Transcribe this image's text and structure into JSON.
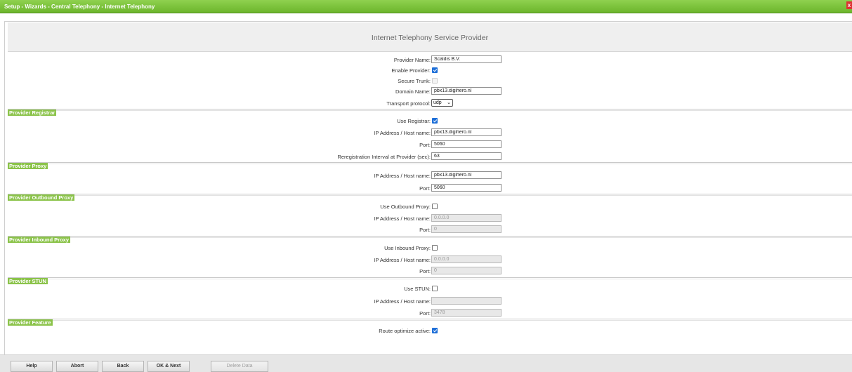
{
  "window": {
    "breadcrumb": "Setup - Wizards - Central Telephony - Internet Telephony",
    "close_glyph": "x"
  },
  "page": {
    "title": "Internet Telephony Service Provider"
  },
  "general": {
    "provider_name_label": "Provider Name:",
    "provider_name_value": "Scaldis B.V.",
    "enable_provider_label": "Enable Provider:",
    "enable_provider_checked": true,
    "secure_trunk_label": "Secure Trunk:",
    "secure_trunk_checked": false,
    "domain_name_label": "Domain Name:",
    "domain_name_value": "pbx13.digihero.nl",
    "transport_label": "Transport protocol:",
    "transport_value": "udp"
  },
  "registrar": {
    "section_label": "Provider Registrar",
    "use_label": "Use Registrar:",
    "use_checked": true,
    "host_label": "IP Address / Host name:",
    "host_value": "pbx13.digihero.nl",
    "port_label": "Port:",
    "port_value": "5060",
    "interval_label": "Reregistration Interval at Provider (sec):",
    "interval_value": "63"
  },
  "proxy": {
    "section_label": "Provider Proxy",
    "host_label": "IP Address / Host name:",
    "host_value": "pbx13.digihero.nl",
    "port_label": "Port:",
    "port_value": "5060"
  },
  "outbound_proxy": {
    "section_label": "Provider Outbound Proxy",
    "use_label": "Use Outbound Proxy:",
    "use_checked": false,
    "host_label": "IP Address / Host name:",
    "host_value": "0.0.0.0",
    "port_label": "Port:",
    "port_value": "0"
  },
  "inbound_proxy": {
    "section_label": "Provider Inbound Proxy",
    "use_label": "Use Inbound Proxy:",
    "use_checked": false,
    "host_label": "IP Address / Host name:",
    "host_value": "0.0.0.0",
    "port_label": "Port:",
    "port_value": "0"
  },
  "stun": {
    "section_label": "Provider STUN",
    "use_label": "Use STUN:",
    "use_checked": false,
    "host_label": "IP Address / Host name:",
    "host_value": "",
    "port_label": "Port:",
    "port_value": "3478"
  },
  "feature": {
    "section_label": "Provider Feature",
    "route_optimize_label": "Route optimize active:",
    "route_optimize_checked": true
  },
  "footer": {
    "help": "Help",
    "abort": "Abort",
    "back": "Back",
    "ok_next": "OK & Next",
    "delete_data": "Delete Data"
  },
  "colors": {
    "titlebar_green": "#6cb52c",
    "section_green": "#8bc34a",
    "checkbox_blue": "#1e6fd8"
  }
}
